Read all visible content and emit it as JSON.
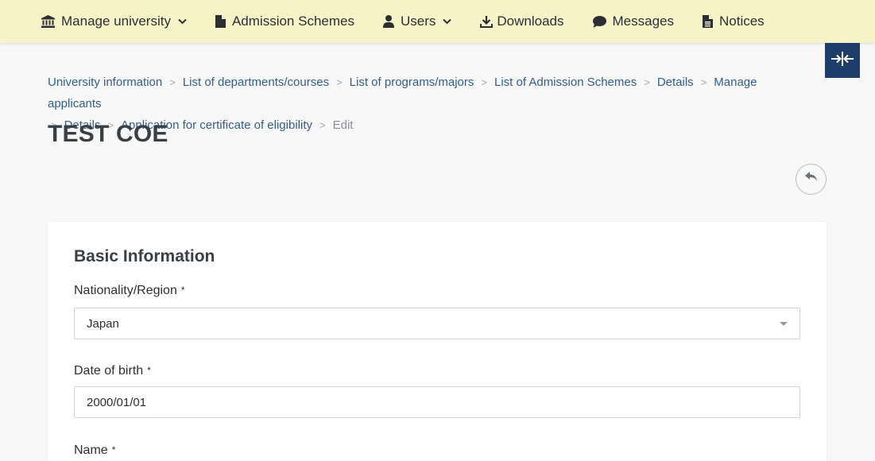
{
  "nav": {
    "items": [
      {
        "label": "Manage university",
        "icon": "bank-icon",
        "dropdown": true
      },
      {
        "label": "Admission Schemes",
        "icon": "file-icon",
        "dropdown": false
      },
      {
        "label": "Users",
        "icon": "user-icon",
        "dropdown": true
      },
      {
        "label": "Downloads",
        "icon": "download-icon",
        "dropdown": false
      },
      {
        "label": "Messages",
        "icon": "comment-icon",
        "dropdown": false
      },
      {
        "label": "Notices",
        "icon": "file-text-icon",
        "dropdown": false
      }
    ]
  },
  "breadcrumb": {
    "items": [
      "University information",
      "List of departments/courses",
      "List of programs/majors",
      "List of Admission Schemes",
      "Details",
      "Manage applicants",
      "Details",
      "Application for certificate of eligibility"
    ],
    "separator": ">",
    "current": "Edit"
  },
  "page": {
    "title": "TEST COE"
  },
  "form": {
    "section_title": "Basic Information",
    "nationality": {
      "label": "Nationality/Region",
      "required_mark": "*",
      "value": "Japan"
    },
    "dob": {
      "label": "Date of birth",
      "required_mark": "*",
      "value": "2000/01/01"
    },
    "name": {
      "label": "Name",
      "required_mark": "*"
    }
  },
  "colors": {
    "nav_bg": "#f7f3c8",
    "link": "#2f5e8e",
    "collapse_button_bg": "#1d3d6b"
  }
}
